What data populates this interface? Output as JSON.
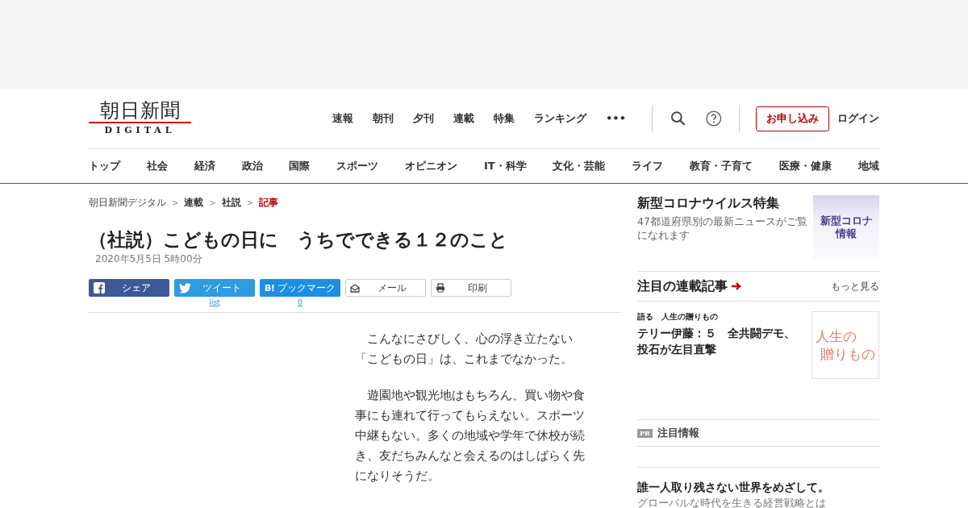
{
  "logo": {
    "title": "朝日新聞",
    "subtitle": "DIGITAL"
  },
  "top_nav": [
    "速報",
    "朝刊",
    "夕刊",
    "連載",
    "特集",
    "ランキング",
    "•••"
  ],
  "subscribe_button": "お申し込み",
  "login_link": "ログイン",
  "categories": [
    "トップ",
    "社会",
    "経済",
    "政治",
    "国際",
    "スポーツ",
    "オピニオン",
    "IT・科学",
    "文化・芸能",
    "ライフ",
    "教育・子育て",
    "医療・健康",
    "地域"
  ],
  "breadcrumbs": [
    {
      "label": "朝日新聞デジタル",
      "selected": false
    },
    {
      "label": "連載",
      "selected": false
    },
    {
      "label": "社説",
      "selected": false
    },
    {
      "label": "記事",
      "selected": true
    }
  ],
  "breadcrumb_separator": ">",
  "article": {
    "title": "（社説）こどもの日に　うちでできる１２のこと",
    "date": "2020年5月5日 5時00分",
    "share_buttons": [
      {
        "kind": "facebook",
        "label": "シェア"
      },
      {
        "kind": "twitter",
        "label": "ツイート",
        "count": "list"
      },
      {
        "kind": "hatena",
        "label": "ブックマーク",
        "count": "0"
      },
      {
        "kind": "mail",
        "label": "メール"
      },
      {
        "kind": "print",
        "label": "印刷"
      }
    ],
    "paragraphs": [
      [
        "　こんなにさびしく、心の浮き立たない",
        "「こどもの日」は、これまでなかった。"
      ],
      [
        "　遊園地や観光地はもちろん、買い物や食",
        "事にも連れて行ってもらえない。スポーツ",
        "中継もない。多くの地域や学年で休校が続",
        "き、友だちみんなと会えるのはしばらく先",
        "になりそうだ。"
      ]
    ]
  },
  "sidebar": {
    "feature": {
      "title": "新型コロナウイルス特集",
      "description": "47都道府県別の最新ニュースがご覧になれます",
      "banner": [
        "新型コロナ",
        "情報"
      ]
    },
    "series": {
      "heading": "注目の連載記事",
      "more": "もっと見る",
      "items": [
        {
          "category": "語る　人生の贈りもの",
          "title": "テリー伊藤：５　全共闘デモ、投石が左目直撃",
          "banner": [
            "人生の",
            "贈りもの"
          ]
        }
      ]
    },
    "pr": {
      "badge": "PR",
      "heading": "注目情報",
      "items": [
        {
          "title": "誰一人取り残さない世界をめざして。",
          "description": "グローバルな時代を生きる経営戦略とは"
        }
      ]
    }
  }
}
